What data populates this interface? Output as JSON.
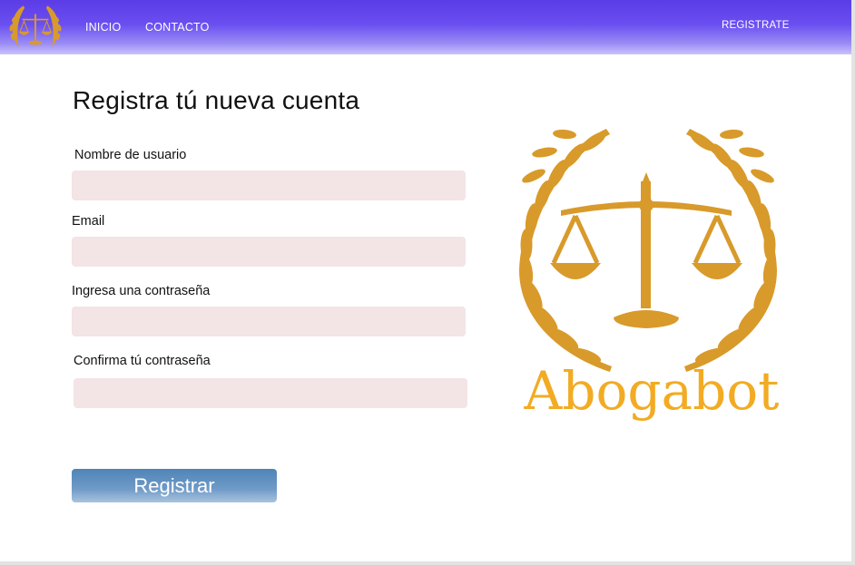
{
  "nav": {
    "logo_icon": "scales-of-justice-laurel-icon",
    "links": [
      {
        "label": "INICIO"
      },
      {
        "label": "CONTACTO"
      }
    ],
    "register_label": "REGISTRATE",
    "gradient_colors": [
      "#5b3ce6",
      "#c9c2fb"
    ]
  },
  "form": {
    "title": "Registra tú nueva cuenta",
    "fields": [
      {
        "label": "Nombre  de usuario",
        "value": "",
        "placeholder": ""
      },
      {
        "label": "Email",
        "value": "",
        "placeholder": ""
      },
      {
        "label": "Ingresa una contraseña",
        "value": "",
        "placeholder": ""
      },
      {
        "label": "Confirma tú contraseña",
        "value": "",
        "placeholder": ""
      }
    ],
    "submit_label": "Registrar",
    "input_bg_color": "#f3e4e5",
    "button_color": "#4f84b8"
  },
  "brand": {
    "name": "Abogabot",
    "logo_icon": "scales-of-justice-laurel-icon",
    "color": "#d89a2a",
    "text_color": "#f2ab22"
  }
}
